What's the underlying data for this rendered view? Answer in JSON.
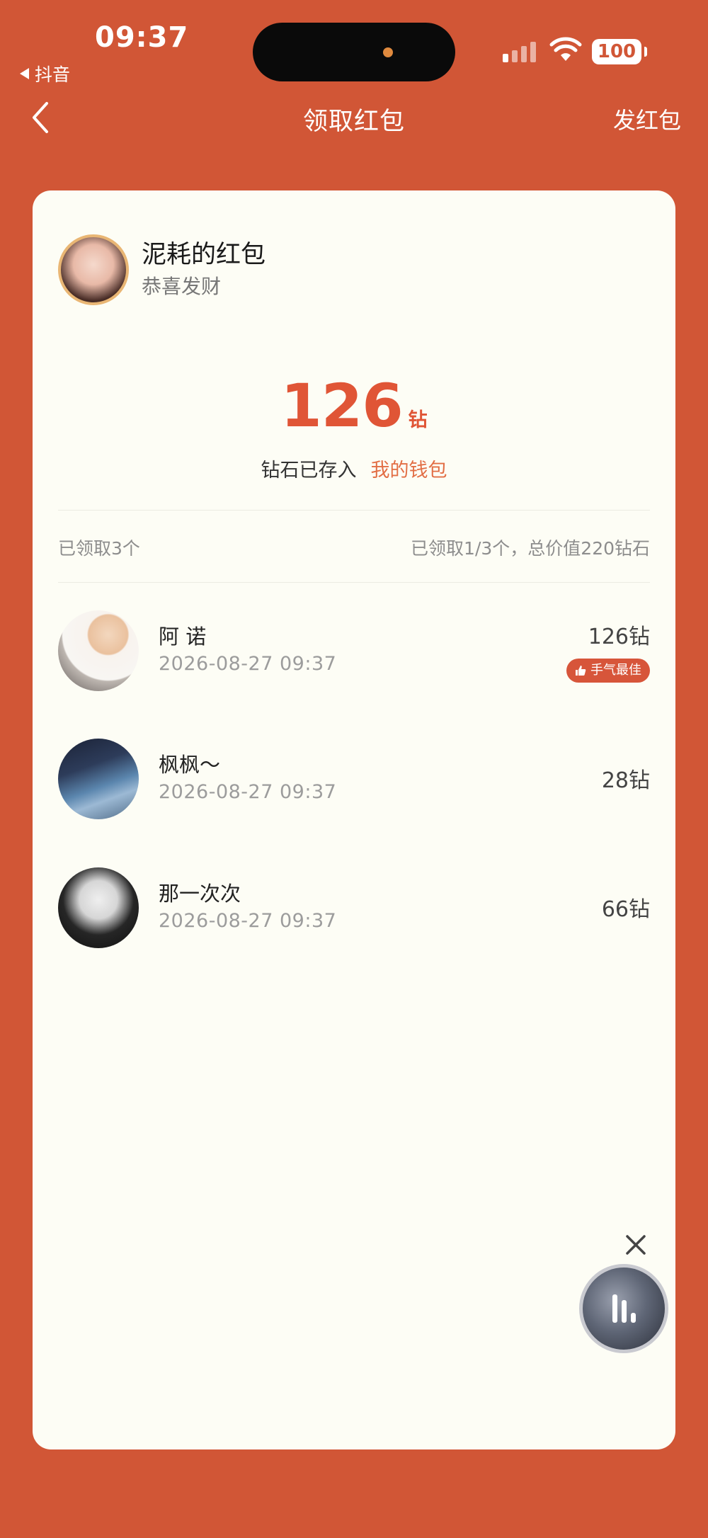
{
  "status_bar": {
    "time": "09:37",
    "back_app": "抖音",
    "battery": "100",
    "icons": [
      "signal-icon",
      "wifi-icon",
      "battery-icon"
    ]
  },
  "nav": {
    "title": "领取红包",
    "action": "发红包",
    "back_icon": "chevron-left-icon"
  },
  "packet": {
    "sender": "泥耗的红包",
    "wish": "恭喜发财",
    "amount": "126",
    "unit": "钻",
    "saved_text": "钻石已存入",
    "wallet_link": "我的钱包"
  },
  "summary": {
    "left": "已领取3个",
    "right": "已领取1/3个，总价值220钻石"
  },
  "claims": [
    {
      "name": "阿 诺",
      "time": "2026-08-27 09:37",
      "amount": "126钻",
      "badge": "手气最佳"
    },
    {
      "name": "枫枫～",
      "time": "2026-08-27 09:37",
      "amount": "28钻"
    },
    {
      "name": "那一次次",
      "time": "2026-08-27 09:37",
      "amount": "66钻"
    }
  ],
  "colors": {
    "background": "#D15636",
    "card": "#FDFDF5",
    "accent": "#E05536",
    "badge": "#D7553A"
  }
}
